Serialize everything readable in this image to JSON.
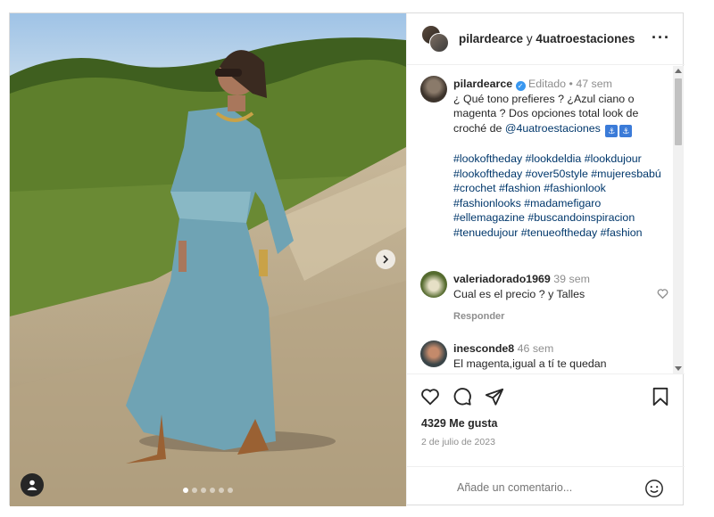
{
  "header": {
    "user1": "pilardearce",
    "conj": "y",
    "user2": "4uatroestaciones",
    "more_icon": "ellipsis-icon"
  },
  "caption": {
    "username": "pilardearce",
    "edited": "Editado",
    "separator": "•",
    "time": "47 sem",
    "text": "¿ Qué tono prefieres ? ¿Azul ciano o magenta ? Dos opciones total look de croché de ",
    "mention": "@4uatroestaciones",
    "hashtags": "#lookoftheday #lookdeldia #lookdujour #lookoftheday #over50style #mujeresbabú #crochet #fashion #fashionlook #fashionlooks #madamefigaro #ellemagazine #buscandoinspiracion #tenuedujour #tenueoftheday #fashion"
  },
  "comments": [
    {
      "username": "valeriadorado1969",
      "time": "39 sem",
      "text": "Cual es el precio ? y Talles",
      "reply": "Responder"
    },
    {
      "username": "inesconde8",
      "time": "46 sem",
      "text": "El magenta,igual a tí te quedan hermosos. Te sigo de"
    }
  ],
  "actions": {
    "likes": "4329 Me gusta",
    "date": "2 de julio de 2023"
  },
  "add_comment": {
    "placeholder": "Añade un comentario..."
  },
  "carousel": {
    "slides": 6,
    "current": 1
  },
  "colors": {
    "link": "#00376b",
    "muted": "#8e8e8e",
    "verified": "#3897f0"
  }
}
